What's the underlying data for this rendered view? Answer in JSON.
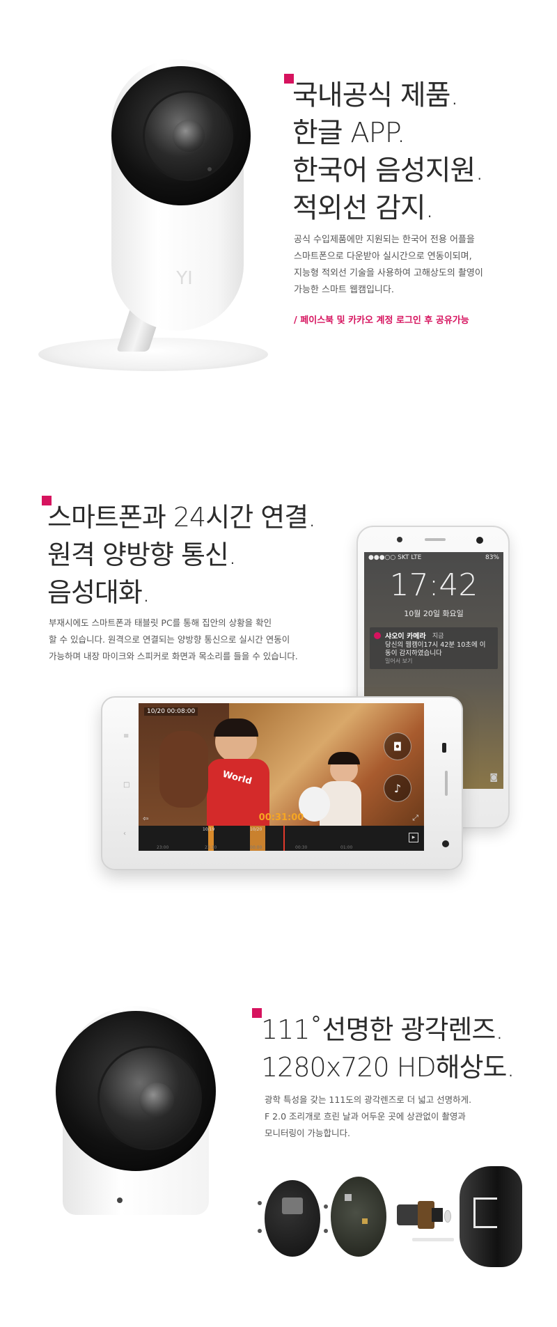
{
  "section1": {
    "heading_lines": [
      "국내공식 제품.",
      "한글 APP.",
      "한국어 음성지원.",
      "적외선 감지."
    ],
    "body_lines": [
      "공식 수입제품에만 지원되는 한국어 전용 어플을",
      "스마트폰으로 다운받아 실시간으로 연동이되며,",
      "지능형 적외선 기술을 사용하여 고해상도의 촬영이",
      "가능한 스마트 웹캠입니다."
    ],
    "note": "/ 페이스북 및 카카오 계정 로그인 후 공유가능",
    "camera_logo": "YI"
  },
  "section2": {
    "heading_lines": [
      "스마트폰과 24시간 연결.",
      "원격 양방향 통신.",
      "음성대화."
    ],
    "body_lines": [
      "부재시에도 스마트폰과 태블릿 PC를 통해 집안의 상황을 확인",
      "할 수 있습니다. 원격으로 연결되는 양방향 통신으로 실시간 연동이",
      "가능하며 내장 마이크와 스피커로 화면과 목소리를 들을 수 있습니다."
    ],
    "lockscreen": {
      "carrier": "●●●○○ SKT  LTE",
      "battery": "83%",
      "time": "17:42",
      "date": "10월 20일 화요일",
      "notif_app": "샤오이 카메라",
      "notif_time": "지금",
      "notif_line1": "당신의 웹캠이17시 42분 10초에 이",
      "notif_line2": "동이 감지하였습니다",
      "notif_action": "밀어서 보기"
    },
    "player": {
      "timestamp": "10/20 00:08:00",
      "current_time": "00:31:00",
      "mark_labels": [
        "10/19",
        "10/20"
      ],
      "tick_labels": [
        "23:00",
        "23:30",
        "00:00",
        "00:30",
        "01:00"
      ],
      "video_overlay_text": "World"
    }
  },
  "section3": {
    "heading_lines": [
      "111˚선명한 광각렌즈.",
      "1280x720  HD해상도."
    ],
    "body_lines": [
      "광학 특성을 갖는 111도의 광각렌즈로 더 넓고 선명하게.",
      "F 2.0 조리개로 흐린 날과 어두운 곳에 상관없이 촬영과",
      "모니터링이 가능합니다."
    ]
  },
  "colors": {
    "accent": "#d6135e",
    "heading": "#2b2b2b",
    "body": "#555555"
  },
  "icons": [
    "camera-icon",
    "microphone-icon",
    "fullscreen-icon",
    "exit-icon",
    "notification-icon"
  ]
}
